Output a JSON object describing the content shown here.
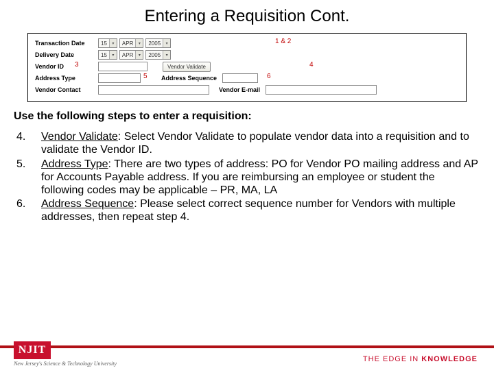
{
  "title": "Entering a Requisition Cont.",
  "form": {
    "rows": {
      "transaction_date": {
        "label": "Transaction Date",
        "day": "15",
        "month": "APR",
        "year": "2005"
      },
      "delivery_date": {
        "label": "Delivery Date",
        "day": "15",
        "month": "APR",
        "year": "2005"
      },
      "vendor_id": {
        "label": "Vendor ID",
        "validate_btn": "Vendor Validate"
      },
      "address_type": {
        "label": "Address Type",
        "seq_label": "Address Sequence"
      },
      "vendor_contact": {
        "label": "Vendor Contact",
        "email_label": "Vendor E-mail"
      }
    },
    "annotations": {
      "a12": "1 & 2",
      "a3": "3",
      "a4": "4",
      "a5": "5",
      "a6": "6"
    }
  },
  "instructions": {
    "heading": "Use the following steps to enter a requisition:",
    "steps": [
      {
        "num": "4.",
        "underline": "Vendor Validate",
        "rest": ":  Select Vendor Validate to populate vendor data into a requisition and to validate the Vendor ID."
      },
      {
        "num": "5.",
        "underline": "Address Type",
        "rest": ":  There are two types of address: PO for Vendor PO mailing address and AP for Accounts Payable address. If you are reimbursing an employee or student the following codes may be applicable – PR, MA, LA"
      },
      {
        "num": "6.",
        "underline": "Address Sequence",
        "rest": ":  Please select correct sequence number for Vendors with multiple addresses, then repeat step 4."
      }
    ]
  },
  "footer": {
    "logo_text": "NJIT",
    "logo_sub": "New Jersey's Science & Technology University",
    "tagline_thin": "THE EDGE IN ",
    "tagline_bold": "KNOWLEDGE"
  }
}
